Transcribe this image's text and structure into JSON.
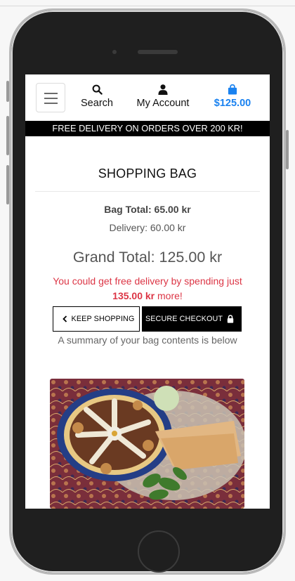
{
  "header": {
    "search_label": "Search",
    "account_label": "My Account",
    "bag_total": "$125.00"
  },
  "banner": {
    "text": "FREE DELIVERY ON ORDERS OVER 200 KR!"
  },
  "main": {
    "title": "SHOPPING BAG",
    "bag_total": "Bag Total: 65.00 kr",
    "delivery": "Delivery: 60.00 kr",
    "grand_total": "Grand Total: 125.00 kr",
    "free_delivery_prefix": "You could get free delivery by spending just",
    "free_delivery_amount": "135.00 kr",
    "free_delivery_suffix": "more!",
    "keep_shopping_label": "KEEP SHOPPING",
    "secure_checkout_label": "SECURE CHECKOUT",
    "summary_text": "A summary of your bag contents is below"
  },
  "icons": {
    "menu": "hamburger-icon",
    "search": "search-icon",
    "account": "user-icon",
    "bag": "shopping-bag-icon",
    "back": "chevron-left-icon",
    "lock": "lock-icon"
  },
  "colors": {
    "accent": "#1a82f0",
    "danger": "#dc3545",
    "banner_bg": "#000000"
  }
}
